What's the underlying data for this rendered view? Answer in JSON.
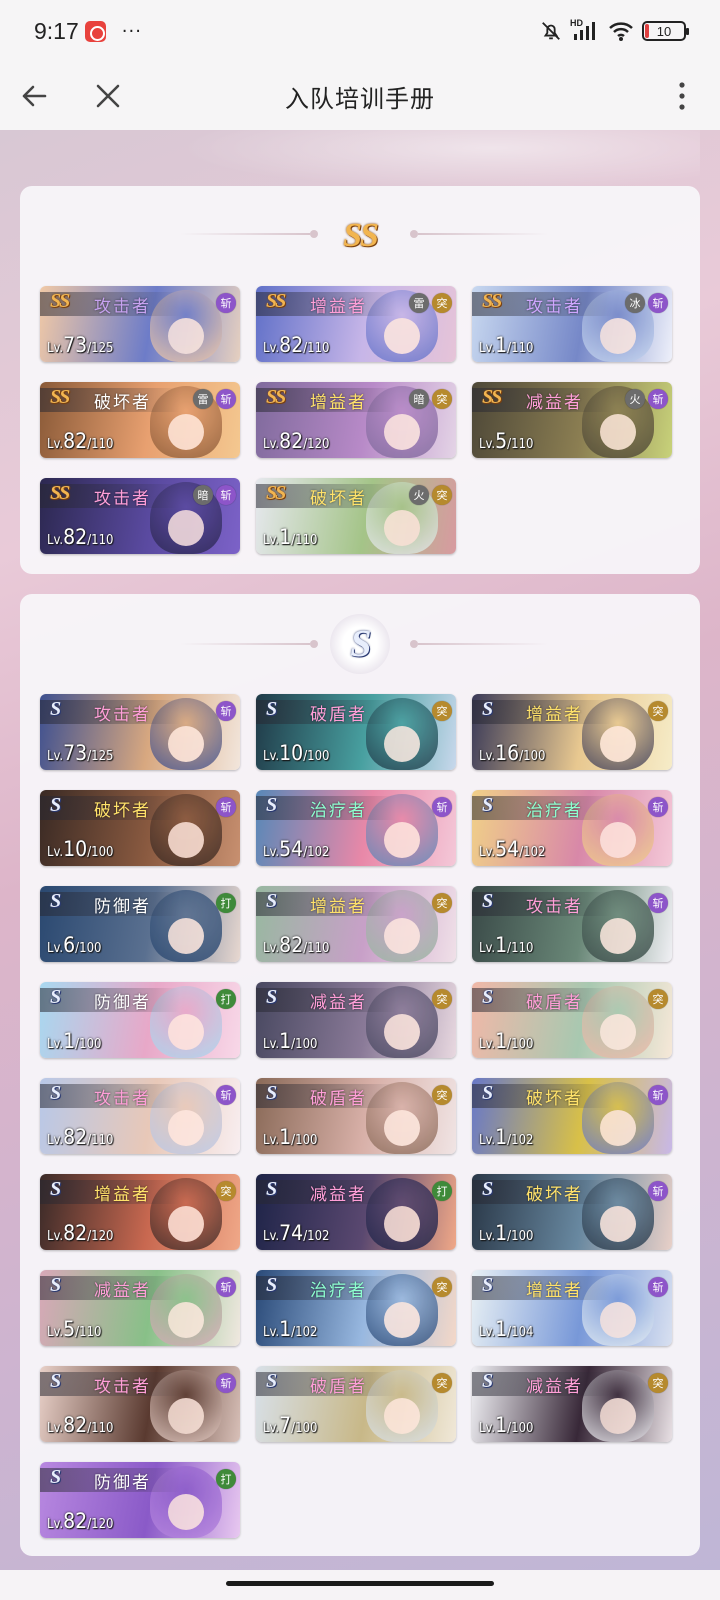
{
  "status_bar": {
    "time": "9:17",
    "dots": "···",
    "battery": "10",
    "battery_fraction": 0.1,
    "network_label": "HD"
  },
  "header": {
    "title": "入队培训手册",
    "back_icon": "arrow-left-icon",
    "close_icon": "close-icon",
    "more_icon": "more-vertical-icon"
  },
  "colors": {
    "ss_gold": "#f2b550",
    "s_silver": "#e8eefc",
    "badge_slash": "#8d55c9",
    "badge_strike": "#3f8a3a",
    "badge_thrust": "#b68a2e",
    "badge_elem": "#6c6c6c"
  },
  "ss_section": {
    "emblem": "SS",
    "cards": [
      {
        "rank": "SS",
        "role": "攻击者",
        "lv": "73",
        "max": "125",
        "badges": [
          "斩"
        ],
        "art": [
          "#f1c9a6",
          "#6d7cc8",
          "#e6d0c0"
        ],
        "role_color": "#c7a2f0"
      },
      {
        "rank": "SS",
        "role": "增益者",
        "lv": "82",
        "max": "110",
        "badges": [
          "雷",
          "突"
        ],
        "art": [
          "#6070c8",
          "#c7b6e8",
          "#e6c4d8"
        ],
        "role_color": "#ff9fd8"
      },
      {
        "rank": "SS",
        "role": "攻击者",
        "lv": "1",
        "max": "110",
        "badges": [
          "冰",
          "斩"
        ],
        "art": [
          "#c8d8f0",
          "#7688c8",
          "#eef0fa"
        ],
        "role_color": "#cfa6ff"
      },
      {
        "rank": "SS",
        "role": "破坏者",
        "lv": "82",
        "max": "110",
        "badges": [
          "雷",
          "斩"
        ],
        "art": [
          "#8a5a38",
          "#e8a070",
          "#f4c890"
        ],
        "role_color": "#ffffff"
      },
      {
        "rank": "SS",
        "role": "增益者",
        "lv": "82",
        "max": "120",
        "badges": [
          "暗",
          "突"
        ],
        "art": [
          "#7f6a9c",
          "#b88ac8",
          "#e4d4e6"
        ],
        "role_color": "#ffe26a"
      },
      {
        "rank": "SS",
        "role": "减益者",
        "lv": "5",
        "max": "110",
        "badges": [
          "火",
          "斩"
        ],
        "art": [
          "#4e4838",
          "#8b7e52",
          "#c8d27a"
        ],
        "role_color": "#ff9fd8"
      },
      {
        "rank": "SS",
        "role": "攻击者",
        "lv": "82",
        "max": "110",
        "badges": [
          "暗",
          "斩"
        ],
        "art": [
          "#2c2850",
          "#5a4aa0",
          "#7c62c8"
        ],
        "role_color": "#ff9fd8"
      },
      {
        "rank": "SS",
        "role": "破坏者",
        "lv": "1",
        "max": "110",
        "badges": [
          "火",
          "突"
        ],
        "art": [
          "#e6e8ee",
          "#a4c488",
          "#d89aa0"
        ],
        "role_color": "#ffe26a"
      }
    ]
  },
  "s_section": {
    "emblem": "S",
    "cards": [
      {
        "rank": "S",
        "role": "攻击者",
        "lv": "73",
        "max": "125",
        "badges": [
          "斩"
        ],
        "art": [
          "#3e5090",
          "#d8a880",
          "#f2e6dc"
        ],
        "role_color": "#ff9fd8"
      },
      {
        "rank": "S",
        "role": "破盾者",
        "lv": "10",
        "max": "100",
        "badges": [
          "突"
        ],
        "art": [
          "#203a48",
          "#48a0a0",
          "#c8d8ec"
        ],
        "role_color": "#ff9fd8"
      },
      {
        "rank": "S",
        "role": "增益者",
        "lv": "16",
        "max": "100",
        "badges": [
          "突"
        ],
        "art": [
          "#3a3a58",
          "#e8c890",
          "#f6ecc8"
        ],
        "role_color": "#ffe26a"
      },
      {
        "rank": "S",
        "role": "破坏者",
        "lv": "10",
        "max": "100",
        "badges": [
          "斩"
        ],
        "art": [
          "#3a2a24",
          "#8a5a40",
          "#c89070"
        ],
        "role_color": "#ffe26a"
      },
      {
        "rank": "S",
        "role": "治疗者",
        "lv": "54",
        "max": "102",
        "badges": [
          "斩"
        ],
        "art": [
          "#5888b8",
          "#e888a8",
          "#f4c8d8"
        ],
        "role_color": "#8effd0"
      },
      {
        "rank": "S",
        "role": "治疗者",
        "lv": "54",
        "max": "102",
        "badges": [
          "斩"
        ],
        "art": [
          "#f0d088",
          "#d888a8",
          "#f4c8d8"
        ],
        "role_color": "#8effd0"
      },
      {
        "rank": "S",
        "role": "防御者",
        "lv": "6",
        "max": "100",
        "badges": [
          "打"
        ],
        "art": [
          "#2a4870",
          "#5a7090",
          "#e8d8d0"
        ],
        "role_color": "#ffffff"
      },
      {
        "rank": "S",
        "role": "增益者",
        "lv": "82",
        "max": "110",
        "badges": [
          "突"
        ],
        "art": [
          "#98b8a0",
          "#c8a0c8",
          "#f0e0e8"
        ],
        "role_color": "#ffe26a"
      },
      {
        "rank": "S",
        "role": "攻击者",
        "lv": "1",
        "max": "110",
        "badges": [
          "斩"
        ],
        "art": [
          "#3a4a48",
          "#6a8878",
          "#f0f0f4"
        ],
        "role_color": "#ff9fd8"
      },
      {
        "rank": "S",
        "role": "防御者",
        "lv": "1",
        "max": "100",
        "badges": [
          "打"
        ],
        "art": [
          "#a8d8f0",
          "#e8a8c8",
          "#f8d8e8"
        ],
        "role_color": "#ffffff"
      },
      {
        "rank": "S",
        "role": "减益者",
        "lv": "1",
        "max": "100",
        "badges": [
          "突"
        ],
        "art": [
          "#484860",
          "#8a7a98",
          "#e8d8e0"
        ],
        "role_color": "#ff9fd8"
      },
      {
        "rank": "S",
        "role": "破盾者",
        "lv": "1",
        "max": "100",
        "badges": [
          "突"
        ],
        "art": [
          "#f0b8a8",
          "#a8c8b0",
          "#f6e8d8"
        ],
        "role_color": "#ff9fd8"
      },
      {
        "rank": "S",
        "role": "攻击者",
        "lv": "82",
        "max": "110",
        "badges": [
          "斩"
        ],
        "art": [
          "#b8c8e8",
          "#e8c8b8",
          "#f8eef0"
        ],
        "role_color": "#ff9fd8"
      },
      {
        "rank": "S",
        "role": "破盾者",
        "lv": "1",
        "max": "100",
        "badges": [
          "突"
        ],
        "art": [
          "#8a6a58",
          "#d8b0a8",
          "#f0e4e4"
        ],
        "role_color": "#ff9fd8"
      },
      {
        "rank": "S",
        "role": "破坏者",
        "lv": "1",
        "max": "102",
        "badges": [
          "斩"
        ],
        "art": [
          "#6878c8",
          "#d8c048",
          "#c8b8e8"
        ],
        "role_color": "#ffe26a"
      },
      {
        "rank": "S",
        "role": "增益者",
        "lv": "82",
        "max": "120",
        "badges": [
          "突"
        ],
        "art": [
          "#3a2a28",
          "#c86850",
          "#f0a888"
        ],
        "role_color": "#ffe26a"
      },
      {
        "rank": "S",
        "role": "减益者",
        "lv": "74",
        "max": "102",
        "badges": [
          "打"
        ],
        "art": [
          "#1e2448",
          "#5a4870",
          "#f0a888"
        ],
        "role_color": "#ff9fd8"
      },
      {
        "rank": "S",
        "role": "破坏者",
        "lv": "1",
        "max": "100",
        "badges": [
          "斩"
        ],
        "art": [
          "#2a3848",
          "#6888a0",
          "#e8d0c8"
        ],
        "role_color": "#ffe26a"
      },
      {
        "rank": "S",
        "role": "减益者",
        "lv": "5",
        "max": "110",
        "badges": [
          "斩"
        ],
        "art": [
          "#d8a8b8",
          "#88c088",
          "#f0e8e0"
        ],
        "role_color": "#ff9fd8"
      },
      {
        "rank": "S",
        "role": "治疗者",
        "lv": "1",
        "max": "102",
        "badges": [
          "突"
        ],
        "art": [
          "#2a4a78",
          "#98b8e0",
          "#f4d8c8"
        ],
        "role_color": "#8effd0"
      },
      {
        "rank": "S",
        "role": "增益者",
        "lv": "1",
        "max": "104",
        "badges": [
          "斩"
        ],
        "art": [
          "#e8f0f4",
          "#7898d8",
          "#d8e0f0"
        ],
        "role_color": "#ffe26a"
      },
      {
        "rank": "S",
        "role": "攻击者",
        "lv": "82",
        "max": "110",
        "badges": [
          "斩"
        ],
        "art": [
          "#e8d0c8",
          "#5a3a30",
          "#d8c0b8"
        ],
        "role_color": "#ff9fd8"
      },
      {
        "rank": "S",
        "role": "破盾者",
        "lv": "7",
        "max": "100",
        "badges": [
          "突"
        ],
        "art": [
          "#d8e0e8",
          "#c8b888",
          "#f0e8d8"
        ],
        "role_color": "#ff9fd8"
      },
      {
        "rank": "S",
        "role": "减益者",
        "lv": "1",
        "max": "100",
        "badges": [
          "突"
        ],
        "art": [
          "#f0f0f4",
          "#382838",
          "#e8e0e4"
        ],
        "role_color": "#ff9fd8"
      },
      {
        "rank": "S",
        "role": "防御者",
        "lv": "82",
        "max": "120",
        "badges": [
          "打"
        ],
        "art": [
          "#b888e0",
          "#8a5ac8",
          "#e8c8f0"
        ],
        "role_color": "#ffffff"
      }
    ]
  }
}
